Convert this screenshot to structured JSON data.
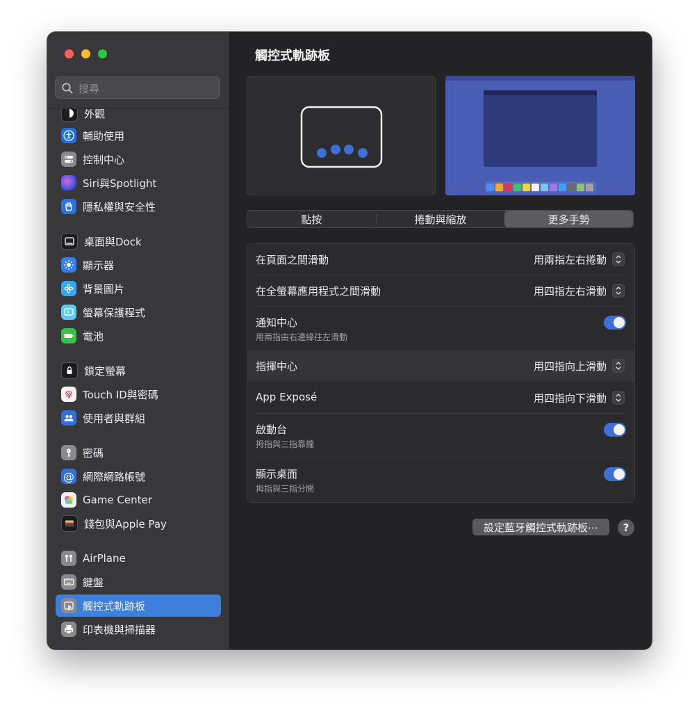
{
  "search": {
    "placeholder": "搜尋"
  },
  "sidebar": {
    "items": [
      {
        "label": "外觀",
        "icon": "appearance-icon",
        "color": "#1c1c1e"
      },
      {
        "label": "輔助使用",
        "icon": "accessibility-icon",
        "color": "#1f6fe0"
      },
      {
        "label": "控制中心",
        "icon": "control-center-icon",
        "color": "#8a8a8e"
      },
      {
        "label": "Siri與Spotlight",
        "icon": "siri-icon",
        "color": "#6b4cc7"
      },
      {
        "label": "隱私權與安全性",
        "icon": "hand-icon",
        "color": "#2f6fe0"
      },
      {
        "label": "桌面與Dock",
        "icon": "desktop-dock-icon",
        "color": "#1c1c1e"
      },
      {
        "label": "顯示器",
        "icon": "display-brightness-icon",
        "color": "#2f7ff0"
      },
      {
        "label": "背景圖片",
        "icon": "wallpaper-icon",
        "color": "#34a8f0"
      },
      {
        "label": "螢幕保護程式",
        "icon": "screensaver-icon",
        "color": "#5ec8f0"
      },
      {
        "label": "電池",
        "icon": "battery-icon",
        "color": "#38c24a"
      },
      {
        "label": "鎖定螢幕",
        "icon": "lock-icon",
        "color": "#1c1c1e"
      },
      {
        "label": "Touch ID與密碼",
        "icon": "fingerprint-icon",
        "color": "#f2f2f2"
      },
      {
        "label": "使用者與群組",
        "icon": "users-icon",
        "color": "#2f6fe0"
      },
      {
        "label": "密碼",
        "icon": "key-icon",
        "color": "#8a8a8e"
      },
      {
        "label": "網際網路帳號",
        "icon": "at-icon",
        "color": "#2f6fe0"
      },
      {
        "label": "Game Center",
        "icon": "game-center-icon",
        "color": "#f2f2f2"
      },
      {
        "label": "錢包與Apple Pay",
        "icon": "wallet-icon",
        "color": "#1c1c1e"
      },
      {
        "label": "AirPlane",
        "icon": "airpods-icon",
        "color": "#8a8a8e"
      },
      {
        "label": "鍵盤",
        "icon": "keyboard-icon",
        "color": "#8a8a8e"
      },
      {
        "label": "觸控式軌跡板",
        "icon": "trackpad-icon",
        "color": "#8a8a8e"
      },
      {
        "label": "印表機與掃描器",
        "icon": "printer-icon",
        "color": "#8a8a8e"
      }
    ],
    "selected": "觸控式軌跡板"
  },
  "main": {
    "title": "觸控式軌跡板",
    "tabs": [
      {
        "label": "點按"
      },
      {
        "label": "捲動與縮放"
      },
      {
        "label": "更多手勢"
      }
    ],
    "active_tab": "更多手勢",
    "rows": [
      {
        "label": "在頁面之間滑動",
        "value": "用兩指左右捲動"
      },
      {
        "label": "在全螢幕應用程式之間滑動",
        "value": "用四指左右滑動"
      },
      {
        "label": "通知中心",
        "sub": "用兩指由右邊緣往左滑動",
        "toggle": true
      },
      {
        "label": "指揮中心",
        "value": "用四指向上滑動"
      },
      {
        "label": "App Exposé",
        "value": "用四指向下滑動"
      },
      {
        "label": "啟動台",
        "sub": "拇指與三指靠攏",
        "toggle": true
      },
      {
        "label": "顯示桌面",
        "sub": "拇指與三指分開",
        "toggle": true
      }
    ],
    "bluetooth_button": "設定藍牙觸控式軌跡板⋯",
    "help_button": "?"
  },
  "colors": {
    "accent": "#3f7fdc",
    "toggle_on": "#3e6fd8",
    "finger_dot": "#3d6fd6",
    "desktop_blue": "#4a5db5"
  }
}
